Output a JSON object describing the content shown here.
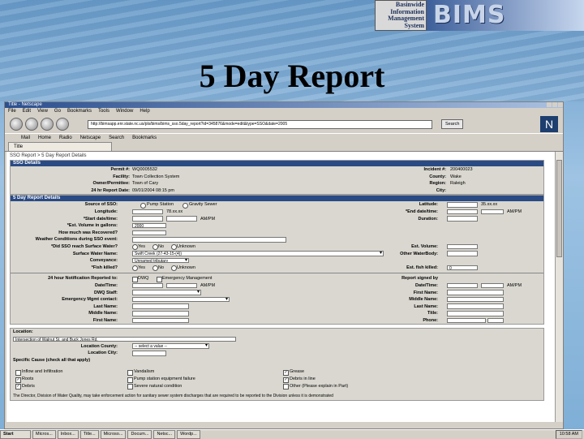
{
  "slide": {
    "title": "5 Day Report",
    "logo_small": [
      "Basinwide",
      "Information",
      "Management",
      "System"
    ],
    "logo_big": "BIMS"
  },
  "browser": {
    "window_title": "Title - Netscape",
    "menu": [
      "File",
      "Edit",
      "View",
      "Go",
      "Bookmarks",
      "Tools",
      "Window",
      "Help"
    ],
    "url": "http://bimsapp.enr.state.nc.us/pls/bims/bims_sso.5day_report?id=345876&mode=edit&type=SSO&date=2005",
    "search_label": "Search",
    "personal_toolbar": [
      "Mail",
      "Home",
      "Radio",
      "Netscape",
      "Search",
      "Bookmarks"
    ],
    "tab_label": "Title"
  },
  "form": {
    "breadcrumb": "SSO Report > 5 Day Report Details",
    "sso_header": "SSO Details",
    "permit_label": "Permit #:",
    "permit_value": "WQ0005532",
    "facility_label": "Facility:",
    "facility_value": "Town Collection System",
    "owner_label": "Owner/Permittee:",
    "owner_value": "Town of Cary",
    "report_date_label": "24 hr Report Date:",
    "report_date_value": "09/01/2004 08:15 pm",
    "incident_label": "Incident #:",
    "incident_value": "200400023",
    "county_label": "County:",
    "county_value": "Wake",
    "region_label": "Region:",
    "region_value": "Raleigh",
    "city_label": "City:",
    "details_header": "5 Day Report Details",
    "source_label": "Source of SSO:",
    "source_options": [
      "Pump Station",
      "Gravity Sewer"
    ],
    "latitude_label": "Latitude:",
    "latitude_value": "35.xx.xx",
    "longitude_label": "Longitude:",
    "longitude_value": "78.xx.xx",
    "start_label": "*Start date/time:",
    "end_label": "*End date/time:",
    "ampm": "AM/PM",
    "volume_label": "*Est. Volume in gallons:",
    "volume_value": "2000",
    "duration_label": "Duration:",
    "recovered_label": "How much was Recovered?",
    "weather_label": "Weather Conditions during SSO event:",
    "surface_water_label": "*Did SSO reach Surface Water?",
    "surface_options": [
      "Yes",
      "No",
      "Unknown"
    ],
    "est_volume_sw_label": "Est. Volume:",
    "other_waterbody_label": "Other WaterBody:",
    "sw_name_label": "Surface Water Name:",
    "sw_name_value": "Swift Creek (27-43-15-(4))",
    "conveyance_label": "Conveyance:",
    "conveyance_value": "Unnamed tributary",
    "fish_label": "*Fish killed?",
    "fish_options": [
      "Yes",
      "No",
      "Unknown"
    ],
    "fish_count_label": "Est. fish killed:",
    "fish_count_value": "0",
    "notif_label": "24 hour Notification Reported to:",
    "notif_options": [
      "DWQ",
      "Emergency Management"
    ],
    "signed_label": "Report signed by",
    "date_time_label": "Date/Time:",
    "dwq_staff_label": "DWQ Staff:",
    "emergency_label": "Emergency Mgmt contact:",
    "last_name_label": "Last Name:",
    "middle_name_label": "Middle Name:",
    "first_name_label": "First Name:",
    "title_label": "Title:",
    "phone_label": "Phone:",
    "location_header": "Location:",
    "location_value": "Intersection of Walnut St. and Buck Jones Rd.",
    "location_county_label": "Location County:",
    "location_county_value": "-- select a value --",
    "location_city_label": "Location City:",
    "causes_label": "Specific Cause (check all that apply)",
    "causes": [
      "Inflow and Infiltration",
      "Vandalism",
      "Grease",
      "Roots",
      "Pump station equipment failure",
      "Debris in line",
      "Debris",
      "Severe natural condition",
      "Other (Please explain in Part)"
    ],
    "cause_checked": [
      false,
      false,
      true,
      true,
      false,
      true,
      true,
      false,
      false
    ],
    "footer_note": "The Director, Division of Water Quality, may take enforcement action for sanitary sewer system discharges that are required to be reported to the Division unless it is demonstrated"
  },
  "taskbar": {
    "start": "Start",
    "items": [
      "Micros...",
      "Inbox...",
      "Title...",
      "Microso...",
      "Docum...",
      "Netsc...",
      "Wordp..."
    ],
    "clock": "10:58 AM"
  }
}
